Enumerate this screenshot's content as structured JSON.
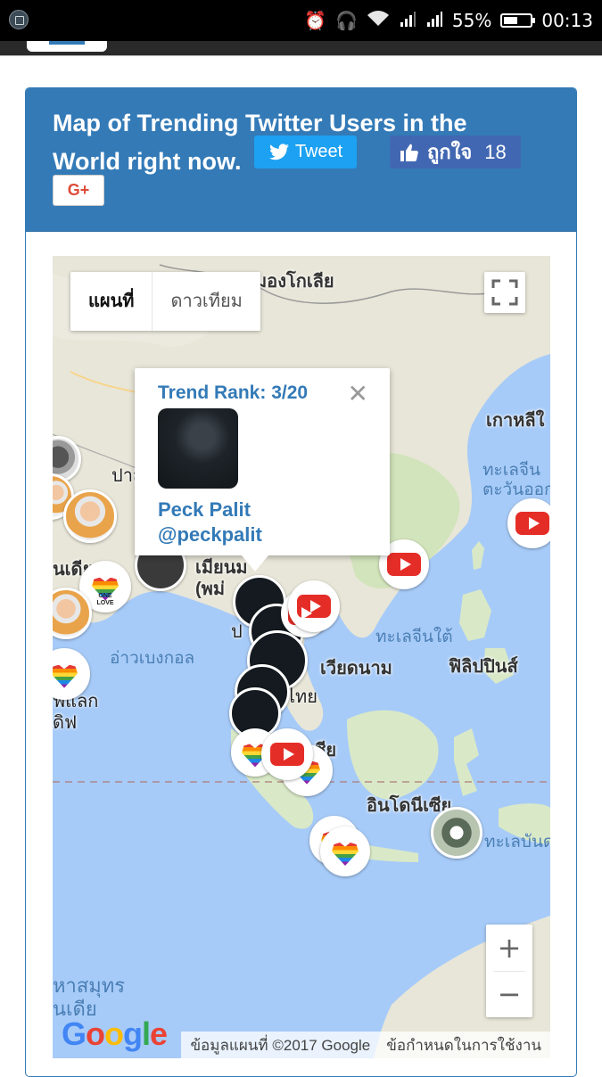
{
  "status_bar": {
    "battery": "55%",
    "time": "00:13",
    "battery_level": 0.55
  },
  "card": {
    "title": "Map of Trending Twitter Users in the World right now.",
    "tweet_label": "Tweet",
    "like_label": "ถูกใจ",
    "like_count": "18",
    "gplus_label": "G+"
  },
  "map": {
    "type_controls": {
      "map": "แผนที่",
      "satellite": "ดาวเทียม"
    },
    "labels": {
      "mongolia": "มองโกเลีย",
      "north_korea": "เกาหลีใ",
      "east_china_sea": "ทะเลจีน\nตะวันออก",
      "south_china_sea": "ทะเลจีนใต้",
      "india": "นเดีย",
      "pakistan": "ปาส",
      "myanmar": "เมียนม\n(พม่",
      "bay_of_bengal": "อ่าวเบงกอล",
      "vietnam": "เวียดนาม",
      "philippines": "ฟิลิปปินส์",
      "thailand": "ไทย",
      "malaysia": "เซีย",
      "indonesia": "อินโดนีเซีย",
      "banda_sea": "ทะเลบันด",
      "maldives": "ัฟแลก\nดิฟ",
      "indian_ocean": "หาสมุทร\nนเดีย",
      "ba": "ป"
    },
    "attribution": "ข้อมูลแผนที่ ©2017 Google",
    "terms": "ข้อกำหนดในการใช้งาน",
    "google_logo": [
      "G",
      "o",
      "o",
      "g",
      "l",
      "e"
    ],
    "zoom_in": "+",
    "zoom_out": "−",
    "marker_love_text": "ONE\nLOVE"
  },
  "info_window": {
    "rank": "Trend Rank: 3/20",
    "close": "✕",
    "name": "Peck Palit",
    "handle": "@peckpalit"
  }
}
